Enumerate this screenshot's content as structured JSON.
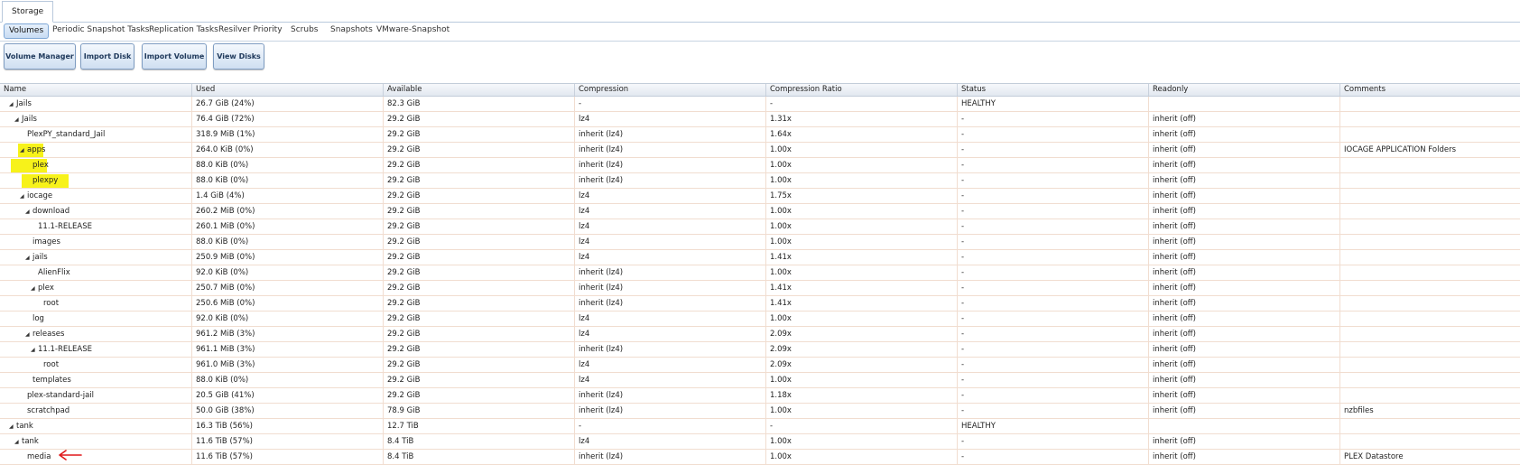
{
  "top_tab": {
    "label": "Storage"
  },
  "subtabs": [
    {
      "label": "Volumes",
      "active": true
    },
    {
      "label": "Periodic Snapshot Tasks"
    },
    {
      "label": "Replication Tasks"
    },
    {
      "label": "Resilver Priority"
    },
    {
      "label": "Scrubs"
    },
    {
      "label": "Snapshots"
    },
    {
      "label": "VMware-Snapshot"
    }
  ],
  "buttons": {
    "volume_manager": "Volume Manager",
    "import_disk": "Import Disk",
    "import_volume": "Import Volume",
    "view_disks": "View Disks"
  },
  "columns": [
    "Name",
    "Used",
    "Available",
    "Compression",
    "Compression Ratio",
    "Status",
    "Readonly",
    "Comments"
  ],
  "rows": [
    {
      "name": "Jails",
      "level": 0,
      "expander": true,
      "used": "26.7 GiB (24%)",
      "available": "82.3 GiB",
      "compression": "-",
      "ratio": "-",
      "status": "HEALTHY",
      "readonly": "",
      "comments": ""
    },
    {
      "name": "Jails",
      "level": 1,
      "expander": true,
      "used": "76.4 GiB (72%)",
      "available": "29.2 GiB",
      "compression": "lz4",
      "ratio": "1.31x",
      "status": "-",
      "readonly": "inherit (off)",
      "comments": ""
    },
    {
      "name": "PlexPY_standard_Jail",
      "level": 2,
      "expander": false,
      "used": "318.9 MiB (1%)",
      "available": "29.2 GiB",
      "compression": "inherit (lz4)",
      "ratio": "1.64x",
      "status": "-",
      "readonly": "inherit (off)",
      "comments": ""
    },
    {
      "name": "apps",
      "level": 2,
      "expander": true,
      "highlight": true,
      "used": "264.0 KiB (0%)",
      "available": "29.2 GiB",
      "compression": "inherit (lz4)",
      "ratio": "1.00x",
      "status": "-",
      "readonly": "inherit (off)",
      "comments": "IOCAGE APPLICATION Folders"
    },
    {
      "name": "plex",
      "level": 3,
      "expander": false,
      "highlight": true,
      "used": "88.0 KiB (0%)",
      "available": "29.2 GiB",
      "compression": "inherit (lz4)",
      "ratio": "1.00x",
      "status": "-",
      "readonly": "inherit (off)",
      "comments": ""
    },
    {
      "name": "plexpy",
      "level": 3,
      "expander": false,
      "highlight": true,
      "used": "88.0 KiB (0%)",
      "available": "29.2 GiB",
      "compression": "inherit (lz4)",
      "ratio": "1.00x",
      "status": "-",
      "readonly": "inherit (off)",
      "comments": ""
    },
    {
      "name": "iocage",
      "level": 2,
      "expander": true,
      "used": "1.4 GiB (4%)",
      "available": "29.2 GiB",
      "compression": "lz4",
      "ratio": "1.75x",
      "status": "-",
      "readonly": "inherit (off)",
      "comments": ""
    },
    {
      "name": "download",
      "level": 3,
      "expander": true,
      "used": "260.2 MiB (0%)",
      "available": "29.2 GiB",
      "compression": "lz4",
      "ratio": "1.00x",
      "status": "-",
      "readonly": "inherit (off)",
      "comments": ""
    },
    {
      "name": "11.1-RELEASE",
      "level": 4,
      "expander": false,
      "used": "260.1 MiB (0%)",
      "available": "29.2 GiB",
      "compression": "lz4",
      "ratio": "1.00x",
      "status": "-",
      "readonly": "inherit (off)",
      "comments": ""
    },
    {
      "name": "images",
      "level": 3,
      "expander": false,
      "used": "88.0 KiB (0%)",
      "available": "29.2 GiB",
      "compression": "lz4",
      "ratio": "1.00x",
      "status": "-",
      "readonly": "inherit (off)",
      "comments": ""
    },
    {
      "name": "jails",
      "level": 3,
      "expander": true,
      "used": "250.9 MiB (0%)",
      "available": "29.2 GiB",
      "compression": "lz4",
      "ratio": "1.41x",
      "status": "-",
      "readonly": "inherit (off)",
      "comments": ""
    },
    {
      "name": "AlienFlix",
      "level": 4,
      "expander": false,
      "used": "92.0 KiB (0%)",
      "available": "29.2 GiB",
      "compression": "inherit (lz4)",
      "ratio": "1.00x",
      "status": "-",
      "readonly": "inherit (off)",
      "comments": ""
    },
    {
      "name": "plex",
      "level": 4,
      "expander": true,
      "used": "250.7 MiB (0%)",
      "available": "29.2 GiB",
      "compression": "inherit (lz4)",
      "ratio": "1.41x",
      "status": "-",
      "readonly": "inherit (off)",
      "comments": ""
    },
    {
      "name": "root",
      "level": 5,
      "expander": false,
      "used": "250.6 MiB (0%)",
      "available": "29.2 GiB",
      "compression": "inherit (lz4)",
      "ratio": "1.41x",
      "status": "-",
      "readonly": "inherit (off)",
      "comments": ""
    },
    {
      "name": "log",
      "level": 3,
      "expander": false,
      "used": "92.0 KiB (0%)",
      "available": "29.2 GiB",
      "compression": "lz4",
      "ratio": "1.00x",
      "status": "-",
      "readonly": "inherit (off)",
      "comments": ""
    },
    {
      "name": "releases",
      "level": 3,
      "expander": true,
      "used": "961.2 MiB (3%)",
      "available": "29.2 GiB",
      "compression": "lz4",
      "ratio": "2.09x",
      "status": "-",
      "readonly": "inherit (off)",
      "comments": ""
    },
    {
      "name": "11.1-RELEASE",
      "level": 4,
      "expander": true,
      "used": "961.1 MiB (3%)",
      "available": "29.2 GiB",
      "compression": "inherit (lz4)",
      "ratio": "2.09x",
      "status": "-",
      "readonly": "inherit (off)",
      "comments": ""
    },
    {
      "name": "root",
      "level": 5,
      "expander": false,
      "used": "961.0 MiB (3%)",
      "available": "29.2 GiB",
      "compression": "lz4",
      "ratio": "2.09x",
      "status": "-",
      "readonly": "inherit (off)",
      "comments": ""
    },
    {
      "name": "templates",
      "level": 3,
      "expander": false,
      "used": "88.0 KiB (0%)",
      "available": "29.2 GiB",
      "compression": "lz4",
      "ratio": "1.00x",
      "status": "-",
      "readonly": "inherit (off)",
      "comments": ""
    },
    {
      "name": "plex-standard-jail",
      "level": 2,
      "expander": false,
      "used": "20.5 GiB (41%)",
      "available": "29.2 GiB",
      "compression": "inherit (lz4)",
      "ratio": "1.18x",
      "status": "-",
      "readonly": "inherit (off)",
      "comments": ""
    },
    {
      "name": "scratchpad",
      "level": 2,
      "expander": false,
      "used": "50.0 GiB (38%)",
      "available": "78.9 GiB",
      "compression": "inherit (lz4)",
      "ratio": "1.00x",
      "status": "-",
      "readonly": "inherit (off)",
      "comments": "nzbfiles"
    },
    {
      "name": "tank",
      "level": 0,
      "expander": true,
      "used": "16.3 TiB (56%)",
      "available": "12.7 TiB",
      "compression": "-",
      "ratio": "-",
      "status": "HEALTHY",
      "readonly": "",
      "comments": ""
    },
    {
      "name": "tank",
      "level": 1,
      "expander": true,
      "used": "11.6 TiB (57%)",
      "available": "8.4 TiB",
      "compression": "lz4",
      "ratio": "1.00x",
      "status": "-",
      "readonly": "inherit (off)",
      "comments": ""
    },
    {
      "name": "media",
      "level": 2,
      "expander": false,
      "used": "11.6 TiB (57%)",
      "available": "8.4 TiB",
      "compression": "inherit (lz4)",
      "ratio": "1.00x",
      "status": "-",
      "readonly": "inherit (off)",
      "comments": "PLEX Datastore"
    }
  ],
  "colors": {
    "highlight": "#f7f21a",
    "annotation_arrow": "#e0191b",
    "row_border": "#f1ddd0"
  },
  "icons": {
    "expander": "triangle-down-icon",
    "annotation": "red-arrow-icon"
  }
}
